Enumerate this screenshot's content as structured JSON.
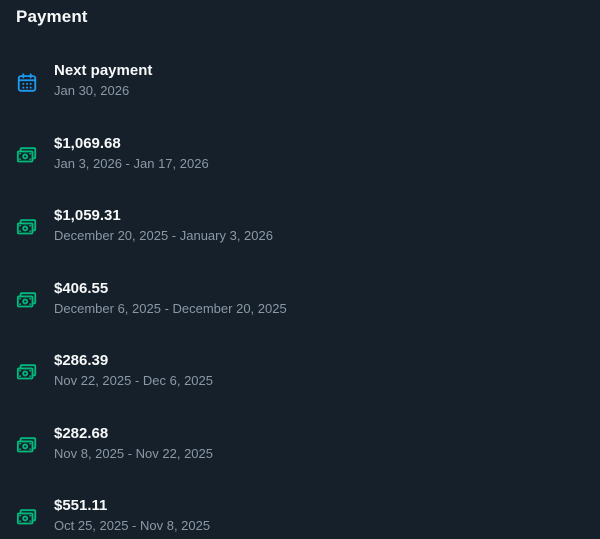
{
  "header": {
    "title": "Payment"
  },
  "colors": {
    "background": "#15202b",
    "calendar_icon": "#1d9bf0",
    "money_icon": "#00ba7c",
    "primary_text": "#f7f9f9",
    "secondary_text": "#8b98a5"
  },
  "next_payment": {
    "icon": "calendar-icon",
    "label": "Next payment",
    "date": "Jan 30, 2026"
  },
  "payments": [
    {
      "icon": "money-icon",
      "amount": "$1,069.68",
      "period": "Jan 3, 2026 - Jan 17, 2026"
    },
    {
      "icon": "money-icon",
      "amount": "$1,059.31",
      "period": "December 20, 2025 - January 3, 2026"
    },
    {
      "icon": "money-icon",
      "amount": "$406.55",
      "period": "December 6, 2025 - December 20, 2025"
    },
    {
      "icon": "money-icon",
      "amount": "$286.39",
      "period": "Nov 22, 2025 - Dec 6, 2025"
    },
    {
      "icon": "money-icon",
      "amount": "$282.68",
      "period": "Nov 8, 2025 - Nov 22, 2025"
    },
    {
      "icon": "money-icon",
      "amount": "$551.11",
      "period": "Oct 25, 2025 - Nov 8, 2025"
    }
  ]
}
